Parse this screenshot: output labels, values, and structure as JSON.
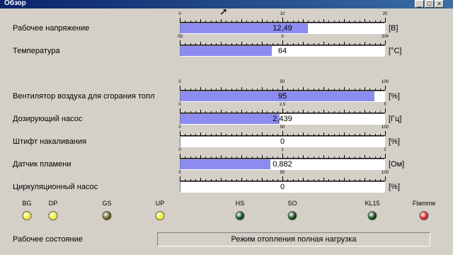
{
  "window": {
    "title": "Обзор",
    "buttons": [
      "_",
      "□",
      "×"
    ]
  },
  "meters": [
    {
      "label": "Рабочее напряжение",
      "min": 0,
      "max": 20,
      "ticks": [
        "0",
        "10",
        "20"
      ],
      "value_text": "12,49",
      "fraction": 0.6245,
      "unit": "[В]"
    },
    {
      "label": "Температура",
      "min": -50,
      "max": 204,
      "ticks": [
        "-50",
        "0",
        "204"
      ],
      "value_text": "64",
      "fraction": 0.449,
      "unit": "[°C]"
    },
    {
      "label": "Вентилятор воздуха для сгорания топл",
      "min": 0,
      "max": 100,
      "ticks": [
        "0",
        "50",
        "100"
      ],
      "value_text": "95",
      "fraction": 0.95,
      "unit": "[%]"
    },
    {
      "label": "Дозирующий насос",
      "min": 0,
      "max": 5,
      "ticks": [
        "0",
        "2,5",
        "5"
      ],
      "value_text": "2,439",
      "fraction": 0.4878,
      "unit": "[Гц]"
    },
    {
      "label": "Штифт накаливания",
      "min": 0,
      "max": 100,
      "ticks": [
        "0",
        "50",
        "100"
      ],
      "value_text": "0",
      "fraction": 0,
      "unit": "[%]"
    },
    {
      "label": "Датчик пламени",
      "min": 0,
      "max": 2,
      "ticks": [
        "0",
        "1",
        "2"
      ],
      "value_text": "0,882",
      "fraction": 0.441,
      "unit": "[Ом]"
    },
    {
      "label": "Циркуляционный насос",
      "min": 0,
      "max": 100,
      "ticks": [
        "0",
        "50",
        "100"
      ],
      "value_text": "0",
      "fraction": 0,
      "unit": "[%]"
    }
  ],
  "leds": [
    {
      "label": "BG",
      "color": "#f2ee2a"
    },
    {
      "label": "DP",
      "color": "#f2ee2a"
    },
    {
      "label": "GS",
      "color": "#6b5e10"
    },
    {
      "label": "UP",
      "color": "#f2ee2a"
    },
    {
      "label": "HS",
      "color": "#0b4a12"
    },
    {
      "label": "SO",
      "color": "#0b4a12"
    },
    {
      "label": "KL15",
      "color": "#0b4a12"
    },
    {
      "label": "Flamme",
      "color": "#e02020"
    }
  ],
  "status": {
    "label": "Рабочее состояние",
    "value": "Режим отопления полная нагрузка"
  }
}
